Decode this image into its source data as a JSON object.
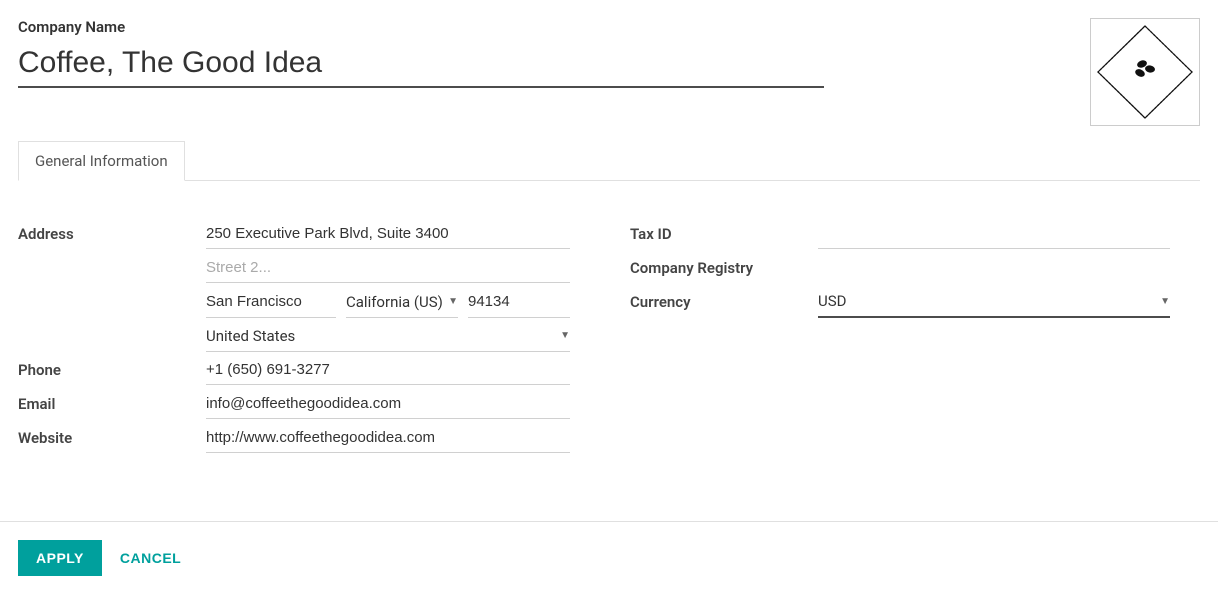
{
  "header": {
    "label": "Company Name",
    "company_name": "Coffee, The Good Idea"
  },
  "tabs": [
    {
      "label": "General Information"
    }
  ],
  "fields": {
    "address": {
      "label": "Address",
      "street": "250 Executive Park Blvd, Suite 3400",
      "street2": "",
      "street2_placeholder": "Street 2...",
      "city": "San Francisco",
      "state": "California (US)",
      "zip": "94134",
      "country": "United States"
    },
    "phone": {
      "label": "Phone",
      "value": "+1 (650) 691-3277"
    },
    "email": {
      "label": "Email",
      "value": "info@coffeethegoodidea.com"
    },
    "website": {
      "label": "Website",
      "value": "http://www.coffeethegoodidea.com"
    },
    "tax_id": {
      "label": "Tax ID",
      "value": ""
    },
    "company_registry": {
      "label": "Company Registry",
      "value": ""
    },
    "currency": {
      "label": "Currency",
      "value": "USD"
    }
  },
  "footer": {
    "apply": "APPLY",
    "cancel": "CANCEL"
  },
  "logo_icon": "coffee-beans-diamond"
}
